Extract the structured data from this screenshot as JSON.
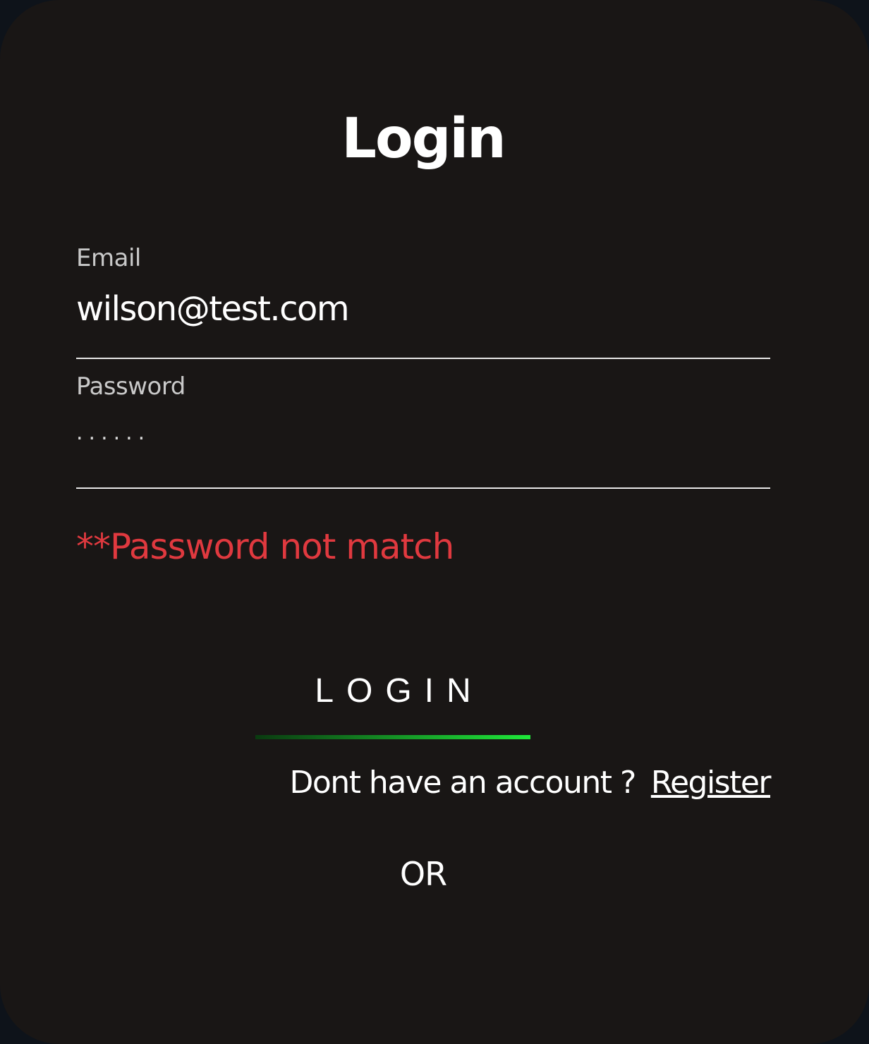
{
  "login_form": {
    "title": "Login",
    "email": {
      "label": "Email",
      "value": "wilson@test.com"
    },
    "password": {
      "label": "Password",
      "masked_value": "......"
    },
    "error_message": "**Password not match",
    "submit_label": "LOGIN",
    "register_prompt": "Dont have an account ?",
    "register_link": "Register",
    "divider_text": "OR"
  },
  "colors": {
    "card_background": "#191615",
    "error": "#e0393f",
    "button_underline_start": "#0a3a10",
    "button_underline_end": "#1fe83a"
  }
}
